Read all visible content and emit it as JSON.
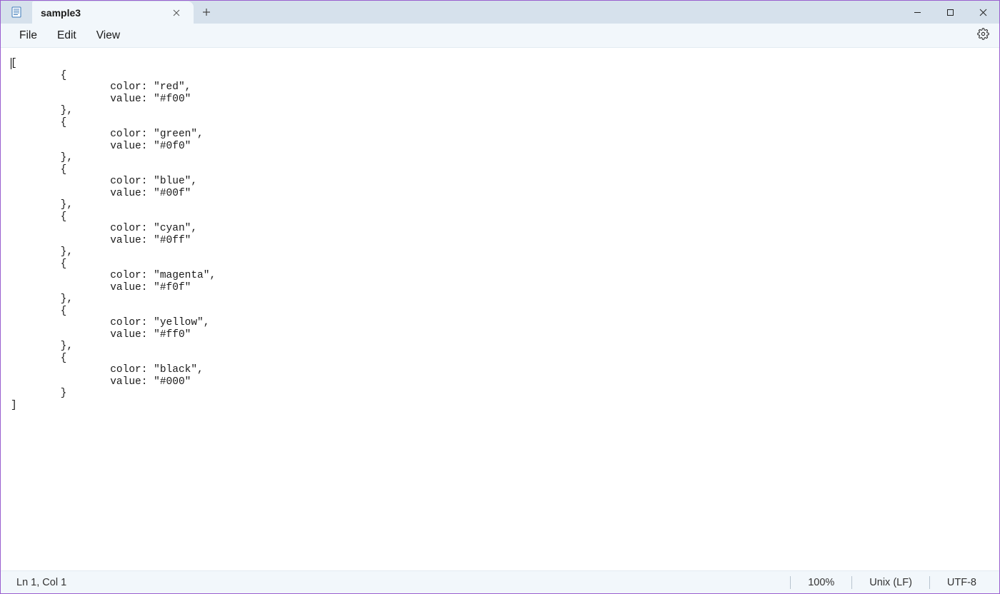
{
  "tab": {
    "title": "sample3"
  },
  "menu": {
    "file": "File",
    "edit": "Edit",
    "view": "View"
  },
  "editor": {
    "content": "[\n\t{\n\t\tcolor: \"red\",\n\t\tvalue: \"#f00\"\n\t},\n\t{\n\t\tcolor: \"green\",\n\t\tvalue: \"#0f0\"\n\t},\n\t{\n\t\tcolor: \"blue\",\n\t\tvalue: \"#00f\"\n\t},\n\t{\n\t\tcolor: \"cyan\",\n\t\tvalue: \"#0ff\"\n\t},\n\t{\n\t\tcolor: \"magenta\",\n\t\tvalue: \"#f0f\"\n\t},\n\t{\n\t\tcolor: \"yellow\",\n\t\tvalue: \"#ff0\"\n\t},\n\t{\n\t\tcolor: \"black\",\n\t\tvalue: \"#000\"\n\t}\n]"
  },
  "status": {
    "position": "Ln 1, Col 1",
    "zoom": "100%",
    "lineEnding": "Unix (LF)",
    "encoding": "UTF-8"
  }
}
